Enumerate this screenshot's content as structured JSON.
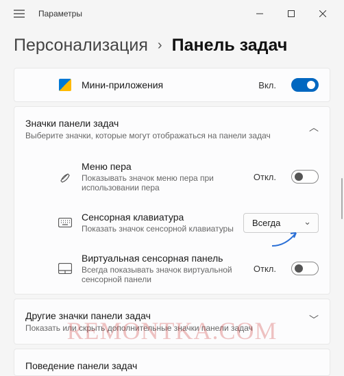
{
  "window": {
    "app_title": "Параметры"
  },
  "breadcrumb": {
    "parent": "Персонализация",
    "current": "Панель задач"
  },
  "widgets": {
    "label": "Мини-приложения",
    "state": "Вкл."
  },
  "section_icons": {
    "title": "Значки панели задач",
    "subtitle": "Выберите значки, которые могут отображаться на панели задач"
  },
  "pen": {
    "title": "Меню пера",
    "subtitle": "Показывать значок меню пера при использовании пера",
    "state": "Откл."
  },
  "touch_keyboard": {
    "title": "Сенсорная клавиатура",
    "subtitle": "Показать значок сенсорной клавиатуры",
    "dropdown": "Всегда"
  },
  "touchpad": {
    "title": "Виртуальная сенсорная панель",
    "subtitle": "Всегда показывать значок виртуальной сенсорной панели",
    "state": "Откл."
  },
  "section_other": {
    "title": "Другие значки панели задач",
    "subtitle": "Показать или скрыть дополнительные значки панели задач"
  },
  "section_behavior": {
    "title": "Поведение панели задач"
  },
  "watermark": "REMONTKA.COM"
}
